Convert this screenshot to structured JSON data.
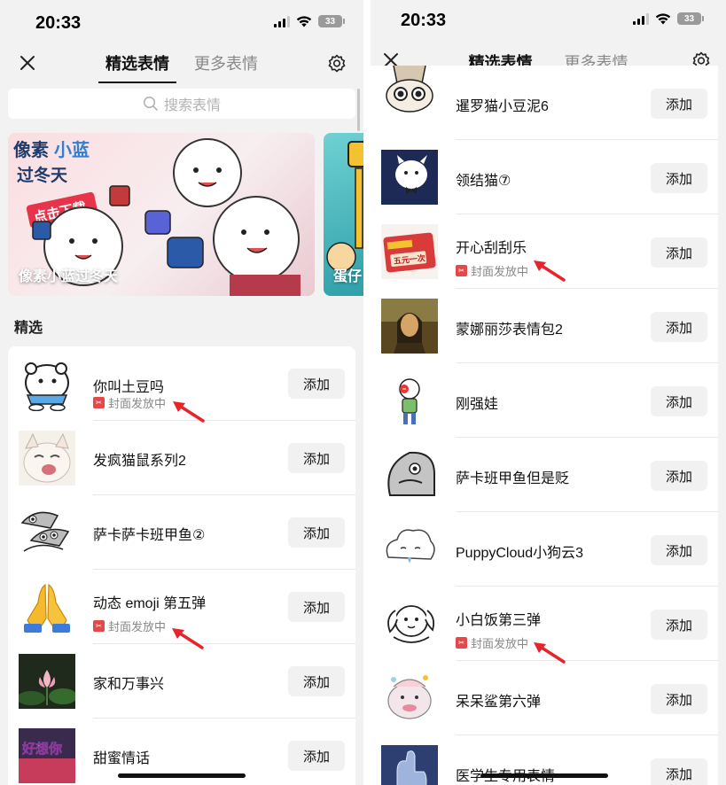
{
  "left": {
    "status": {
      "time": "20:33",
      "battery": "33"
    },
    "nav": {
      "tab_active": "精选表情",
      "tab_other": "更多表情"
    },
    "search": {
      "placeholder": "搜索表情"
    },
    "banner": {
      "caption": "像素小蓝过冬天",
      "art_text": [
        "像素",
        "小蓝",
        "过冬天",
        "点击下载"
      ]
    },
    "banner_partial": {
      "caption": "蛋仔"
    },
    "section_title": "精选",
    "items": [
      {
        "name": "你叫土豆吗",
        "badge": "封面发放中",
        "button": "添加",
        "thumb": "white-bear-sticker"
      },
      {
        "name": "发疯猫鼠系列2",
        "button": "添加",
        "thumb": "crazy-cat-sticker"
      },
      {
        "name": "萨卡萨卡班甲鱼②",
        "button": "添加",
        "thumb": "fish-sticker"
      },
      {
        "name": "动态 emoji 第五弹",
        "badge": "封面发放中",
        "button": "添加",
        "thumb": "praying-hands-emoji"
      },
      {
        "name": "家和万事兴",
        "button": "添加",
        "thumb": "lotus-flower-sticker"
      },
      {
        "name": "甜蜜情话",
        "button": "添加",
        "thumb": "love-words-sticker",
        "thumb_text": "好想你"
      }
    ]
  },
  "right": {
    "status": {
      "time": "20:33",
      "battery": "33"
    },
    "nav": {
      "tab_active": "精选表情",
      "tab_other": "更多表情"
    },
    "items": [
      {
        "name": "暹罗猫小豆泥6",
        "button": "添加",
        "thumb": "siamese-cat-sticker"
      },
      {
        "name": "领结猫⑦",
        "button": "添加",
        "thumb": "bowtie-cat-sticker"
      },
      {
        "name": "开心刮刮乐",
        "badge": "封面发放中",
        "button": "添加",
        "thumb": "scratch-card-sticker",
        "thumb_text": "五元一次"
      },
      {
        "name": "蒙娜丽莎表情包2",
        "button": "添加",
        "thumb": "mona-lisa-sticker"
      },
      {
        "name": "刚强娃",
        "button": "添加",
        "thumb": "strong-kid-sticker"
      },
      {
        "name": "萨卡班甲鱼但是贬",
        "button": "添加",
        "thumb": "fish-face-sticker"
      },
      {
        "name": "PuppyCloud小狗云3",
        "button": "添加",
        "thumb": "puppy-cloud-sticker"
      },
      {
        "name": "小白饭第三弹",
        "badge": "封面发放中",
        "button": "添加",
        "thumb": "white-dog-sticker"
      },
      {
        "name": "呆呆鲨第六弹",
        "button": "添加",
        "thumb": "shark-sticker"
      },
      {
        "name": "医学生专用表情",
        "button": "添加",
        "thumb": "medical-student-sticker"
      }
    ]
  },
  "colors": {
    "accent_badge": "#e24a4a",
    "arrow": "#e8232a",
    "background": "#f2f2f2"
  }
}
